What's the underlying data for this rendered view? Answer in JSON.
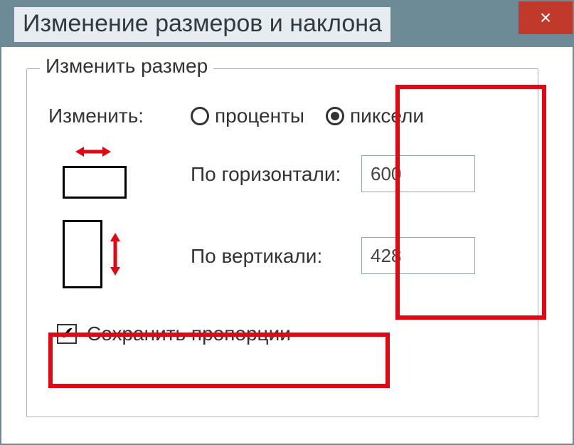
{
  "window": {
    "title": "Изменение размеров и наклона",
    "close": "×"
  },
  "group": {
    "legend": "Изменить размер",
    "change_label": "Изменить:",
    "radio_percent": "проценты",
    "radio_pixels": "пиксели",
    "horiz_label": "По горизонтали:",
    "vert_label": "По вертикали:",
    "horiz_value": "600",
    "vert_value": "428",
    "keep_ratio_label": "Сохранить пропорции",
    "keep_ratio_check": "✔"
  }
}
